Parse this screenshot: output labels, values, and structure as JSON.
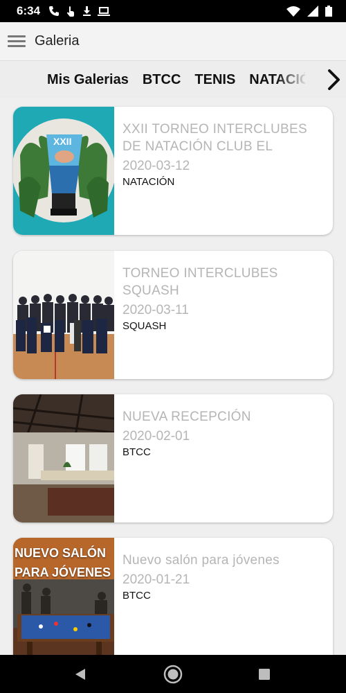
{
  "status": {
    "time": "6:34"
  },
  "appbar": {
    "title": "Galeria"
  },
  "tabs": [
    "Mis Galerias",
    "BTCC",
    "TENIS",
    "NATACIÓN"
  ],
  "cards": [
    {
      "title": "XXII TORNEO INTERCLUBES DE NATACIÓN CLUB EL",
      "date": "2020-03-12",
      "category": "NATACIÓN"
    },
    {
      "title": "TORNEO INTERCLUBES SQUASH",
      "date": "2020-03-11",
      "category": "SQUASH"
    },
    {
      "title": "NUEVA RECEPCIÓN",
      "date": "2020-02-01",
      "category": "BTCC"
    },
    {
      "title": "Nuevo salón para jóvenes",
      "date": "2020-01-21",
      "category": "BTCC",
      "image_caption": "NUEVO SALÓN PARA JÓVENES"
    }
  ],
  "colors": {
    "accent_teal": "#1fa9b5",
    "card_text_muted": "#b5b5b5"
  }
}
